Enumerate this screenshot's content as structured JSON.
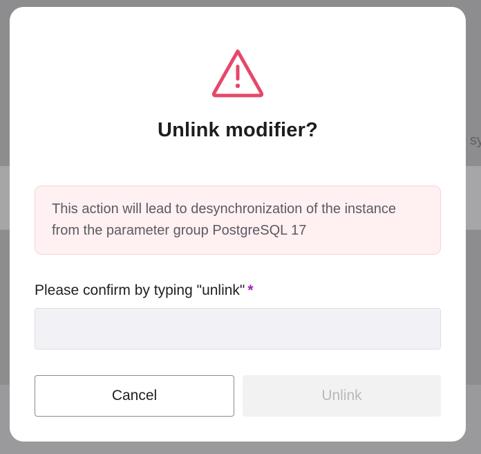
{
  "background": {
    "partial_text": "sy"
  },
  "dialog": {
    "icon": "warning-triangle-icon",
    "title": "Unlink modifier?",
    "alert_text": "This action will lead to desynchronization of the instance from the parameter group PostgreSQL 17",
    "confirm_label": "Please confirm by typing \"unlink\"",
    "required_marker": "*",
    "confirm_input_value": "",
    "cancel_label": "Cancel",
    "unlink_label": "Unlink"
  },
  "colors": {
    "warning_icon": "#e5486a",
    "alert_background": "#fff0f2",
    "required_marker": "#a21fc0",
    "disabled_text": "#b9b9bd"
  }
}
